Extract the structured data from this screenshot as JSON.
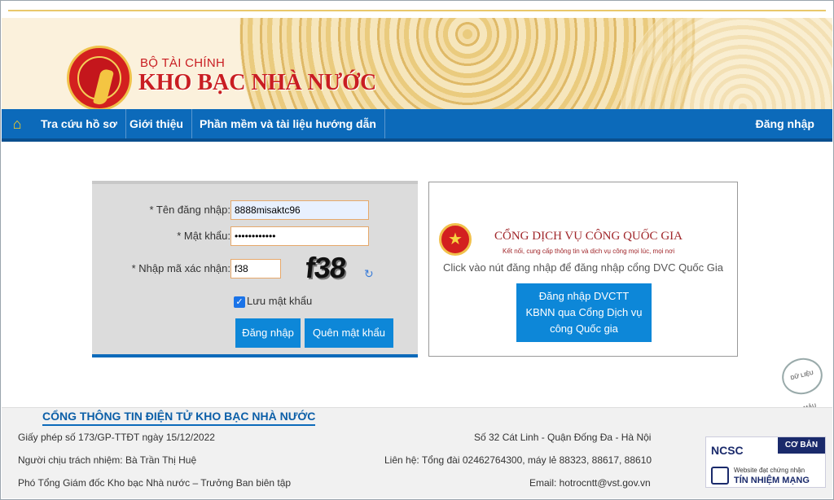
{
  "header": {
    "ministry": "BỘ TÀI CHÍNH",
    "org": "KHO BẠC NHÀ NƯỚC"
  },
  "nav": {
    "items": [
      {
        "label": "Tra cứu hồ sơ"
      },
      {
        "label": "Giới thiệu"
      },
      {
        "label": "Phần mềm và tài liệu hướng dẫn"
      }
    ],
    "login": "Đăng nhập"
  },
  "login_form": {
    "username_label": "* Tên đăng nhập:",
    "username_value": "8888misaktc96",
    "password_label": "* Mật khẩu:",
    "password_value": "••••••••••••",
    "captcha_label": "* Nhập mã xác nhận:",
    "captcha_value": "f38",
    "captcha_image_text": "f38",
    "remember_label": "Lưu mật khẩu",
    "remember_checked": true,
    "login_button": "Đăng nhập",
    "forgot_button": "Quên mật khẩu"
  },
  "dvc": {
    "brand": "CỔNG DỊCH VỤ CÔNG QUỐC GIA",
    "brand_sub": "Kết nối, cung cấp thông tin và dịch vụ công mọi lúc, mọi nơi",
    "hint": "Click vào nút đăng nhập để đăng nhập cổng DVC Quốc Gia",
    "button": "Đăng nhập DVCTT KBNN qua Cổng Dịch vụ công Quốc gia"
  },
  "stamp": "DỮ LIỆU MẪU",
  "footer": {
    "title": "CỔNG THÔNG TIN ĐIỆN TỬ KHO BẠC NHÀ NƯỚC",
    "license": "Giấy phép số 173/GP-TTĐT ngày 15/12/2022",
    "responsible": "Người chịu trách nhiệm: Bà Trần Thị Huệ",
    "editor": "Phó Tổng Giám đốc Kho bạc Nhà nước – Trưởng Ban biên tập",
    "address": "Số 32 Cát Linh - Quận Đống Đa - Hà Nội",
    "contact": "Liên hệ: Tổng đài 02462764300, máy lẻ 88323, 88617, 88610",
    "email": "Email: hotrocntt@vst.gov.vn"
  },
  "badge": {
    "ncsc": "NCSC",
    "level": "CƠ BẢN",
    "sub": "Website đạt chứng nhận",
    "title": "TÍN NHIỆM MẠNG"
  },
  "icons": [
    "home-icon",
    "refresh-icon",
    "checkbox-icon"
  ]
}
